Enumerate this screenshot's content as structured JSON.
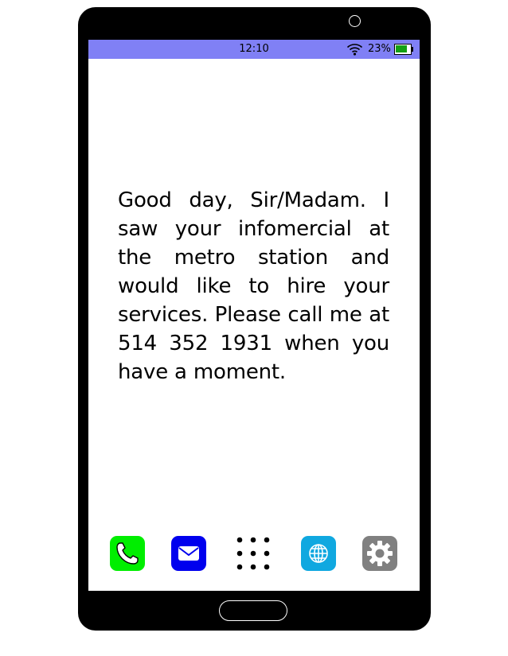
{
  "status_bar": {
    "time": "12:10",
    "battery_percent_label": "23%",
    "battery_level": 0.23,
    "wifi_icon": "wifi-icon",
    "background_color": "#8080f5"
  },
  "message": {
    "text": "Good day, Sir/Madam.  I saw your infomercial at the metro station and would like to hire your services. Please call me at 514 352 1931 when you have a mo­ment."
  },
  "dock": {
    "items": [
      {
        "icon": "phone-icon",
        "color": "#00ee00"
      },
      {
        "icon": "mail-icon",
        "color": "#0000ee"
      },
      {
        "icon": "app-grid-icon",
        "color": "#000000"
      },
      {
        "icon": "globe-icon",
        "color": "#10a8e0"
      },
      {
        "icon": "gear-icon",
        "color": "#808080"
      }
    ]
  }
}
